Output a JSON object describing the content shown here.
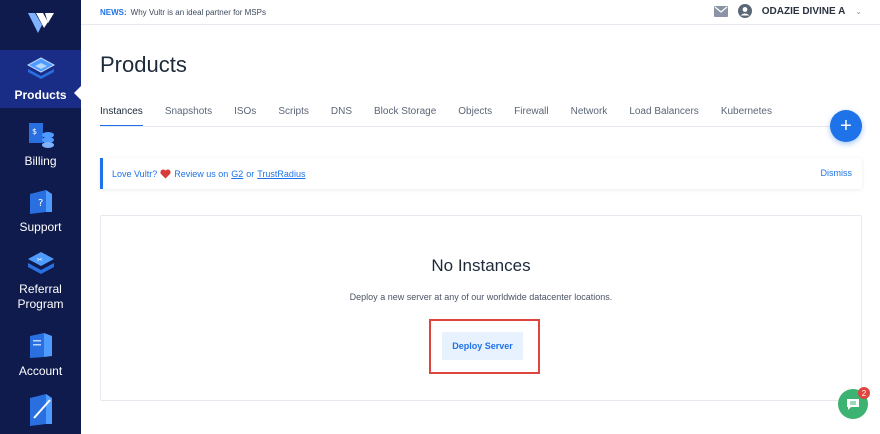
{
  "sidebar": {
    "items": [
      {
        "label": "Products",
        "icon": "products-icon"
      },
      {
        "label": "Billing",
        "icon": "billing-icon"
      },
      {
        "label": "Support",
        "icon": "support-icon"
      },
      {
        "label": "Referral Program",
        "icon": "referral-icon"
      },
      {
        "label": "Account",
        "icon": "account-icon"
      }
    ]
  },
  "topbar": {
    "news_label": "NEWS:",
    "news_text": "Why Vultr is an ideal partner for MSPs",
    "user_name": "ODAZIE DIVINE A"
  },
  "page": {
    "title": "Products"
  },
  "tabs": [
    "Instances",
    "Snapshots",
    "ISOs",
    "Scripts",
    "DNS",
    "Block Storage",
    "Objects",
    "Firewall",
    "Network",
    "Load Balancers",
    "Kubernetes"
  ],
  "banner": {
    "prefix": "Love Vultr?",
    "middle": "Review us on",
    "link1": "G2",
    "or": "or",
    "link2": "TrustRadius",
    "dismiss": "Dismiss"
  },
  "empty_state": {
    "title": "No Instances",
    "subtitle": "Deploy a new server at any of our worldwide datacenter locations.",
    "button": "Deploy Server"
  },
  "chat": {
    "badge_count": "2"
  },
  "colors": {
    "sidebar_bg": "#0f1b4d",
    "accent": "#1e73e8",
    "highlight": "#e0443e",
    "chat": "#3cb371"
  }
}
